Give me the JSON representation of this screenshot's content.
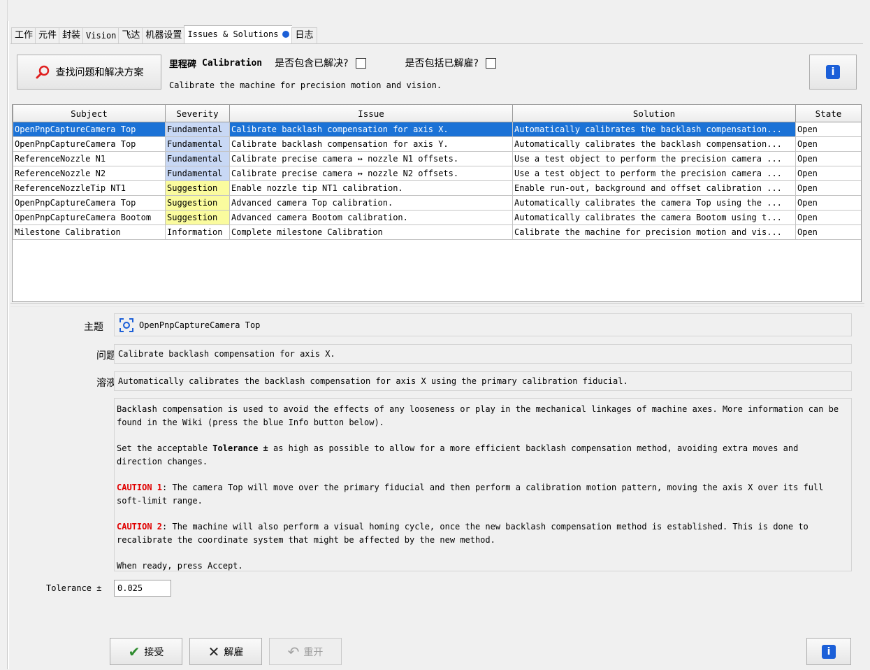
{
  "tabs": [
    {
      "label": "工作"
    },
    {
      "label": "元件"
    },
    {
      "label": "封装"
    },
    {
      "label": "Vision"
    },
    {
      "label": "飞达"
    },
    {
      "label": "机器设置"
    },
    {
      "label": "Issues & Solutions"
    },
    {
      "label": "日志"
    }
  ],
  "toolbar": {
    "find_button": "查找问题和解决方案",
    "milestone_prefix": "里程碑",
    "milestone_name": "Calibration",
    "include_solved_label": "是否包含已解决?",
    "include_solved_checked": false,
    "include_dismissed_label": "是否包括已解雇?",
    "include_dismissed_checked": false,
    "milestone_description": "Calibrate the machine for precision motion and vision."
  },
  "table": {
    "columns": [
      "Subject",
      "Severity",
      "Issue",
      "Solution",
      "State"
    ],
    "rows": [
      {
        "subject": "OpenPnpCaptureCamera Top",
        "severity": "Fundamental",
        "issue": "Calibrate backlash compensation for axis X.",
        "solution": "Automatically calibrates the backlash compensation...",
        "state": "Open"
      },
      {
        "subject": "OpenPnpCaptureCamera Top",
        "severity": "Fundamental",
        "issue": "Calibrate backlash compensation for axis Y.",
        "solution": "Automatically calibrates the backlash compensation...",
        "state": "Open"
      },
      {
        "subject": "ReferenceNozzle N1",
        "severity": "Fundamental",
        "issue": "Calibrate precise camera ↔ nozzle N1 offsets.",
        "solution": "Use a test object to perform the precision camera ...",
        "state": "Open"
      },
      {
        "subject": "ReferenceNozzle N2",
        "severity": "Fundamental",
        "issue": "Calibrate precise camera ↔ nozzle N2 offsets.",
        "solution": "Use a test object to perform the precision camera ...",
        "state": "Open"
      },
      {
        "subject": "ReferenceNozzleTip NT1",
        "severity": "Suggestion",
        "issue": "Enable nozzle tip NT1 calibration.",
        "solution": "Enable run-out, background and offset calibration ...",
        "state": "Open"
      },
      {
        "subject": "OpenPnpCaptureCamera Top",
        "severity": "Suggestion",
        "issue": "Advanced camera Top calibration.",
        "solution": "Automatically calibrates the camera Top using the ...",
        "state": "Open"
      },
      {
        "subject": "OpenPnpCaptureCamera Bootom",
        "severity": "Suggestion",
        "issue": "Advanced camera Bootom calibration.",
        "solution": "Automatically calibrates the camera Bootom using t...",
        "state": "Open"
      },
      {
        "subject": "Milestone Calibration",
        "severity": "Information",
        "issue": "Complete milestone Calibration",
        "solution": "Calibrate the machine for precision motion and vis...",
        "state": "Open"
      }
    ]
  },
  "detail": {
    "subject_label": "主题",
    "subject_value": "OpenPnpCaptureCamera Top",
    "issue_label": "问题",
    "issue_value": "Calibrate backlash compensation for axis X.",
    "solution_label": "溶液",
    "solution_value": "Automatically calibrates the backlash compensation for axis X using the primary calibration fiducial.",
    "p1": "Backlash compensation is used to avoid the effects of any looseness or play in the mechanical linkages of machine axes. More information can be found in the Wiki (press the blue Info button below).",
    "p2_before": "Set the acceptable ",
    "p2_bold": "Tolerance ±",
    "p2_after": " as high as possible to allow for a more efficient backlash compensation method, avoiding extra moves and direction changes.",
    "p3_caution": "CAUTION 1",
    "p3_text": ": The camera Top will move over the primary fiducial and then perform a calibration motion pattern, moving the axis X over its full soft-limit range.",
    "p4_caution": "CAUTION 2",
    "p4_text": ": The machine will also perform a visual homing cycle, once the new backlash compensation method is established. This is done to recalibrate the coordinate system that might be affected by the new method.",
    "p5": "When ready, press Accept.",
    "tolerance_label": "Tolerance ±",
    "tolerance_value": "0.025"
  },
  "actions": {
    "accept": "接受",
    "dismiss": "解雇",
    "reopen": "重开"
  },
  "colors": {
    "selection": "#1b72d6",
    "fundamental": "#c8d8f5",
    "suggestion": "#fafb9e",
    "info_button": "#1b5fd8",
    "caution": "#e00000",
    "accept_check": "#2e8b2e"
  },
  "icons": [
    "search-icon",
    "info-icon",
    "camera-focus-icon",
    "check-icon",
    "x-icon",
    "undo-icon"
  ]
}
